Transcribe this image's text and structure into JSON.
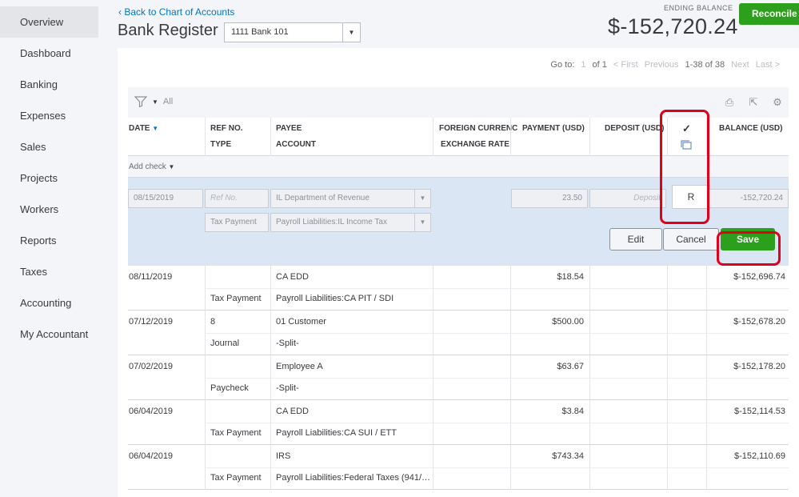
{
  "sidebar": {
    "items": [
      {
        "label": "Overview",
        "name": "sidebar-item-overview"
      },
      {
        "label": "Dashboard",
        "name": "sidebar-item-dashboard"
      },
      {
        "label": "Banking",
        "name": "sidebar-item-banking"
      },
      {
        "label": "Expenses",
        "name": "sidebar-item-expenses"
      },
      {
        "label": "Sales",
        "name": "sidebar-item-sales"
      },
      {
        "label": "Projects",
        "name": "sidebar-item-projects"
      },
      {
        "label": "Workers",
        "name": "sidebar-item-workers"
      },
      {
        "label": "Reports",
        "name": "sidebar-item-reports"
      },
      {
        "label": "Taxes",
        "name": "sidebar-item-taxes"
      },
      {
        "label": "Accounting",
        "name": "sidebar-item-accounting"
      },
      {
        "label": "My Accountant",
        "name": "sidebar-item-my-accountant"
      }
    ]
  },
  "header": {
    "back_link": "Back to Chart of Accounts",
    "title": "Bank Register",
    "account": "1111 Bank 101",
    "ending_label": "ENDING BALANCE",
    "ending_value": "$-152,720.24",
    "reconcile": "Reconcile"
  },
  "pager": {
    "goto": "Go to:",
    "page": "1",
    "of": "of 1",
    "first": "< First",
    "previous": "Previous",
    "range": "1-38 of 38",
    "next": "Next",
    "last": "Last >"
  },
  "toolbar": {
    "filter": "All"
  },
  "columns": {
    "date": "DATE",
    "ref": "REF NO.",
    "type": "TYPE",
    "payee": "PAYEE",
    "account": "ACCOUNT",
    "foreign": "FOREIGN CURRENC",
    "exchange": "EXCHANGE RATE",
    "payment": "PAYMENT (USD)",
    "deposit": "DEPOSIT (USD)",
    "check": "✓",
    "balance": "BALANCE (USD)"
  },
  "add_check": "Add check",
  "edit_row": {
    "date": "08/15/2019",
    "ref_placeholder": "Ref No.",
    "payee": "IL Department of Revenue",
    "payment": "23.50",
    "deposit_placeholder": "Deposit",
    "reconcile_status": "R",
    "balance": "-152,720.24",
    "type": "Tax Payment",
    "account": "Payroll Liabilities:IL Income Tax",
    "edit": "Edit",
    "cancel": "Cancel",
    "save": "Save"
  },
  "rows": [
    {
      "date": "08/11/2019",
      "ref": "",
      "payee": "CA EDD",
      "payment": "$18.54",
      "balance": "$-152,696.74",
      "type": "Tax Payment",
      "account": "Payroll Liabilities:CA PIT / SDI"
    },
    {
      "date": "07/12/2019",
      "ref": "8",
      "payee": "01 Customer",
      "payment": "$500.00",
      "balance": "$-152,678.20",
      "type": "Journal",
      "account": "-Split-"
    },
    {
      "date": "07/02/2019",
      "ref": "",
      "payee": "Employee A",
      "payment": "$63.67",
      "balance": "$-152,178.20",
      "type": "Paycheck",
      "account": "-Split-"
    },
    {
      "date": "06/04/2019",
      "ref": "",
      "payee": "CA EDD",
      "payment": "$3.84",
      "balance": "$-152,114.53",
      "type": "Tax Payment",
      "account": "Payroll Liabilities:CA SUI / ETT"
    },
    {
      "date": "06/04/2019",
      "ref": "",
      "payee": "IRS",
      "payment": "$743.34",
      "balance": "$-152,110.69",
      "type": "Tax Payment",
      "account": "Payroll Liabilities:Federal Taxes (941/…"
    }
  ],
  "colors": {
    "accent_green": "#2ca01c",
    "link_blue": "#0077c5",
    "negative_red": "#d52b1e",
    "annotation_red": "#e0001b"
  }
}
